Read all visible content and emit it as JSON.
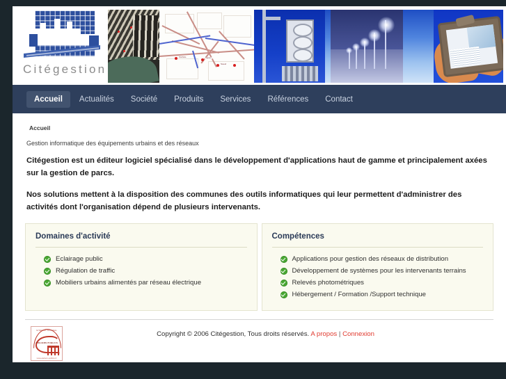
{
  "site": {
    "logo_text": "Citégestion",
    "logo_icon": "city-grid-logo"
  },
  "banner": {
    "images": [
      {
        "name": "aerial-photo-harbour",
        "alt": "Photographie aérienne du port"
      },
      {
        "name": "street-map",
        "alt": "Plan cadastral avec points d'équipement"
      },
      {
        "name": "traffic-signal",
        "alt": "Feu de signalisation"
      },
      {
        "name": "night-street-lighting",
        "alt": "Eclairage public nocturne"
      },
      {
        "name": "rugged-tablet",
        "alt": "Terminal mobile durci"
      }
    ]
  },
  "nav": {
    "items": [
      {
        "label": "Accueil",
        "active": true
      },
      {
        "label": "Actualités",
        "active": false
      },
      {
        "label": "Société",
        "active": false
      },
      {
        "label": "Produits",
        "active": false
      },
      {
        "label": "Services",
        "active": false
      },
      {
        "label": "Références",
        "active": false
      },
      {
        "label": "Contact",
        "active": false
      }
    ]
  },
  "breadcrumb": {
    "text": "Accueil"
  },
  "main": {
    "subtitle": "Gestion informatique des équipements urbains et des réseaux",
    "paragraph1": "Citégestion est un éditeur logiciel spécialisé dans le développement d'applications haut de gamme et principalement axées sur la gestion de parcs.",
    "paragraph2": "Nos solutions mettent à la disposition des communes des outils informatiques qui leur permettent d'administrer des activités dont l'organisation dépend de plusieurs intervenants."
  },
  "panels": [
    {
      "title": "Domaines d'activité",
      "items": [
        "Eclairage public",
        "Régulation de traffic",
        "Mobiliers urbains alimentés par réseau électrique"
      ]
    },
    {
      "title": "Compétences",
      "items": [
        "Applications pour gestion des réseaux de distribution",
        "Développement de systèmes pour les intervenants terrains",
        "Relevés photométriques",
        "Hébergement / Formation /Support technique",
        ""
      ]
    }
  ],
  "footer": {
    "copyright": "Copyright © 2006 Citégestion, Tous droits réservés.",
    "link_about": "A propos",
    "separator": "|",
    "link_login": "Connexion",
    "logo": {
      "name": "ateliers-publics-badge",
      "arc_text": "SYNDICAT NATIONAL",
      "mid_text": "ATELIERS PUBLICS",
      "url_text": "www.ateliers-publics.fr"
    }
  },
  "colors": {
    "nav_bg": "#2e3f5c",
    "nav_active_bg": "#42536f",
    "panel_bg": "#fafaef",
    "panel_border": "#e4e4cf",
    "check_green": "#49a832",
    "link_red": "#e03a2f",
    "logo_blue": "#2d4f9e",
    "desktop_bg": "#1b262c"
  }
}
